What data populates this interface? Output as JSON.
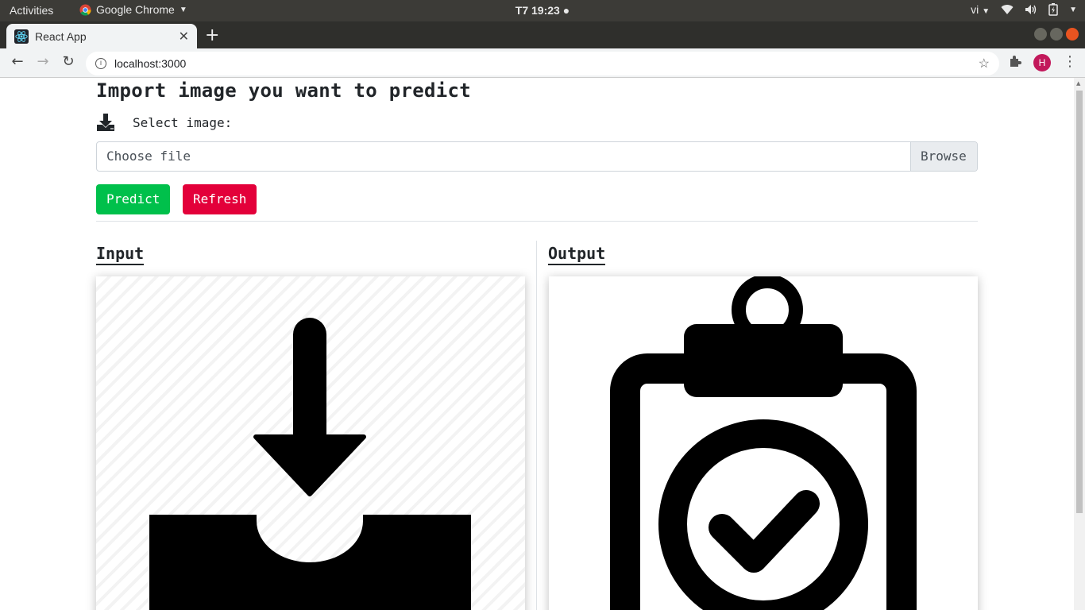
{
  "os_bar": {
    "activities": "Activities",
    "app_name": "Google Chrome",
    "clock": "T7 19:23",
    "input_method": "vi"
  },
  "browser": {
    "tab_title": "React App",
    "url": "localhost:3000",
    "profile_initial": "H"
  },
  "page": {
    "heading": "Import image you want to predict",
    "select_label": "Select image:",
    "file_placeholder": "Choose file",
    "browse_label": "Browse",
    "predict_label": "Predict",
    "refresh_label": "Refresh",
    "input_title": "Input",
    "output_title": "Output",
    "input_icon": "inbox-download-icon",
    "output_icon": "clipboard-check-icon"
  },
  "colors": {
    "predict": "#00c04b",
    "refresh": "#e3003a",
    "text": "#212529"
  }
}
